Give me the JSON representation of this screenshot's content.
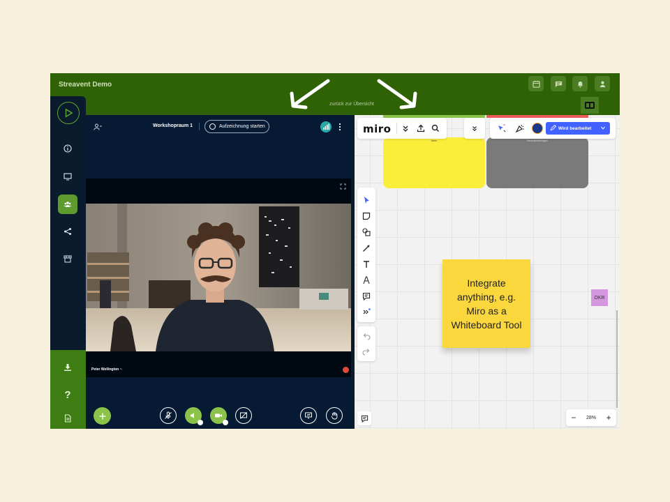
{
  "app": {
    "title": "Streavent Demo",
    "back_link": "zurück zur Übersicht"
  },
  "topbar": {
    "icons": [
      "calendar-icon",
      "chat-icon",
      "bell-icon",
      "user-icon"
    ],
    "exit_icon": "fullscreen-exit-icon"
  },
  "sidebar": {
    "items": [
      {
        "name": "play-icon"
      },
      {
        "name": "info-icon"
      },
      {
        "name": "monitor-icon"
      },
      {
        "name": "group-icon",
        "active": true
      },
      {
        "name": "share-icon"
      },
      {
        "name": "store-icon"
      }
    ],
    "bottom_items": [
      {
        "name": "download-icon"
      },
      {
        "name": "help-icon",
        "glyph": "?"
      },
      {
        "name": "document-icon"
      }
    ]
  },
  "video": {
    "room_name": "Workshopraum 1",
    "record_label": "Aufzeichnung starten",
    "speaker_name": "Peter Wellington ~"
  },
  "miro": {
    "logo": "miro",
    "edit_label": "Wird bearbeitet",
    "frame_yellow_label": "Ideen",
    "frame_gray_label": "Herausforderungen",
    "sticky_text": "Integrate anything, e.g. Miro as a Whiteboard Tool",
    "okr_label": "OKR",
    "zoom": "28%",
    "zoom_minus": "−",
    "zoom_plus": "+"
  },
  "colors": {
    "topbar": "#2f6205",
    "sidebar_active": "#5f9a2e",
    "video_bg": "#061a33",
    "miro_blue": "#4262ff",
    "sticky": "#fbd73e"
  }
}
